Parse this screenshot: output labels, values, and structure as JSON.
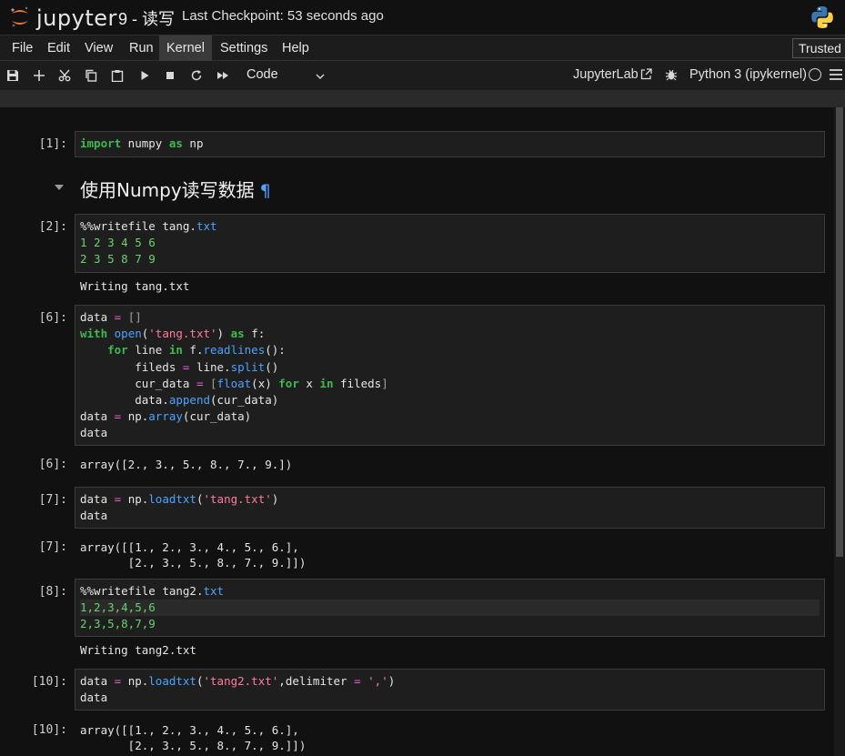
{
  "header": {
    "logo_text": "jupyter",
    "notebook_name": "9 - 读写",
    "checkpoint": "Last Checkpoint: 53 seconds ago"
  },
  "menubar": {
    "items": [
      "File",
      "Edit",
      "View",
      "Run",
      "Kernel",
      "Settings",
      "Help"
    ],
    "active": "Kernel",
    "trusted": "Trusted"
  },
  "toolbar": {
    "icons": [
      "save-icon",
      "add-icon",
      "cut-icon",
      "copy-icon",
      "paste-icon",
      "run-icon",
      "stop-icon",
      "restart-icon",
      "fast-forward-icon"
    ],
    "cell_type": "Code",
    "jupyterlab_label": "JupyterLab",
    "kernel_name": "Python 3 (ipykernel)"
  },
  "cells": {
    "c1": {
      "prompt": "[1]:"
    },
    "heading": {
      "text": "使用Numpy读写数据",
      "anchor": "¶"
    },
    "c2": {
      "prompt": "[2]:",
      "output": "Writing tang.txt"
    },
    "c3": {
      "prompt": "[6]:",
      "out_prompt": "[6]:",
      "output": "array([2., 3., 5., 8., 7., 9.])"
    },
    "c4": {
      "prompt": "[7]:",
      "out_prompt": "[7]:",
      "output_l1": "array([[1., 2., 3., 4., 5., 6.],",
      "output_l2": "       [2., 3., 5., 8., 7., 9.]])"
    },
    "c5": {
      "prompt": "[8]:",
      "output": "Writing tang2.txt"
    },
    "c6": {
      "prompt": "[10]:",
      "out_prompt": "[10]:",
      "output_l1": "array([[1., 2., 3., 4., 5., 6.],",
      "output_l2": "       [2., 3., 5., 8., 7., 9.]])"
    }
  },
  "colors": {
    "keyword": "#3fb950",
    "builtin": "#4da3ff",
    "string": "#ff7b9c",
    "number": "#6cd36c",
    "background": "#111111"
  }
}
